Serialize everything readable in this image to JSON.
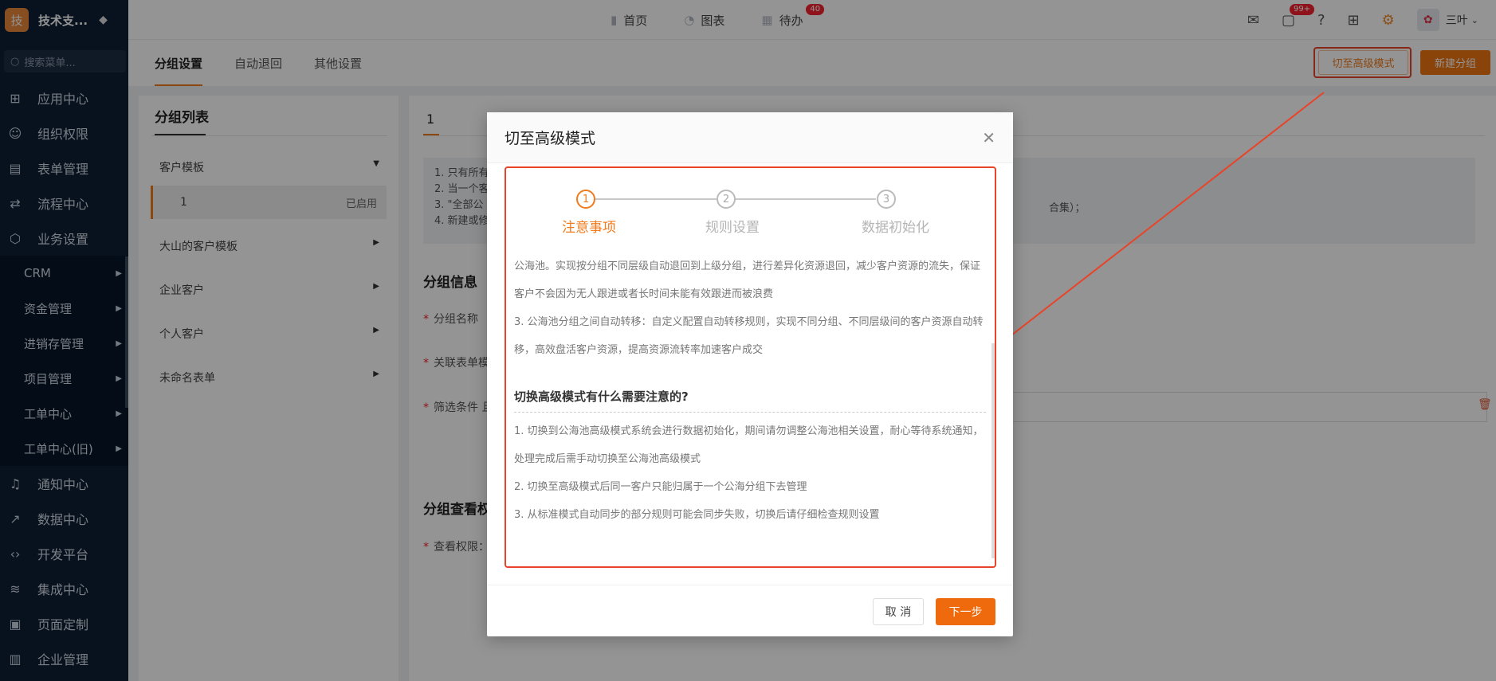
{
  "brand": {
    "logo_char": "技",
    "name": "技术支..."
  },
  "sidebar": {
    "search_placeholder": "搜索菜单...",
    "items_top": [
      {
        "label": "应用中心",
        "icon": "grid-icon"
      },
      {
        "label": "组织权限",
        "icon": "user-icon"
      },
      {
        "label": "表单管理",
        "icon": "form-icon"
      },
      {
        "label": "流程中心",
        "icon": "flow-icon"
      },
      {
        "label": "业务设置",
        "icon": "cube-icon"
      }
    ],
    "sub_items": [
      "CRM",
      "资金管理",
      "进销存管理",
      "项目管理",
      "工单中心",
      "工单中心(旧)"
    ],
    "items_bottom": [
      {
        "label": "通知中心",
        "icon": "bell-icon"
      },
      {
        "label": "数据中心",
        "icon": "chart-icon"
      },
      {
        "label": "开发平台",
        "icon": "code-icon"
      },
      {
        "label": "集成中心",
        "icon": "layers-icon"
      },
      {
        "label": "页面定制",
        "icon": "layout-icon"
      },
      {
        "label": "企业管理",
        "icon": "building-icon"
      }
    ]
  },
  "topnav": {
    "home": "首页",
    "charts": "图表",
    "todo": "待办",
    "todo_badge": "40",
    "msg_badge": "99+",
    "user": "三叶"
  },
  "tabs": [
    "分组设置",
    "自动退回",
    "其他设置"
  ],
  "buttons": {
    "advanced": "切至高级模式",
    "new_group": "新建分组"
  },
  "left_panel": {
    "title": "分组列表",
    "groups": [
      {
        "name": "客户模板",
        "expanded": true,
        "rows": [
          {
            "name": "1",
            "status": "已启用"
          }
        ]
      },
      {
        "name": "大山的客户模板"
      },
      {
        "name": "企业客户"
      },
      {
        "name": "个人客户"
      },
      {
        "name": "未命名表单"
      }
    ]
  },
  "right_panel": {
    "tab": "1",
    "notice": [
      "1. 只有所有",
      "2. 当一个客",
      "3. \"全部公",
      "4. 新建或修"
    ],
    "notice_tail": "合集）；",
    "section1": "分组信息",
    "fields": [
      "分组名称",
      "关联表单模",
      "筛选条件 且"
    ],
    "section2": "分组查看权",
    "field_view": "查看权限："
  },
  "modal": {
    "title": "切至高级模式",
    "steps": [
      {
        "num": "1",
        "label": "注意事项",
        "active": true
      },
      {
        "num": "2",
        "label": "规则设置",
        "active": false
      },
      {
        "num": "3",
        "label": "数据初始化",
        "active": false
      }
    ],
    "para1": "公海池。实现按分组不同层级自动退回到上级分组，进行差异化资源退回，减少客户资源的流失，保证客户不会因为无人跟进或者长时间未能有效跟进而被浪费",
    "para2": "3. 公海池分组之间自动转移：自定义配置自动转移规则，实现不同分组、不同层级间的客户资源自动转移，高效盘活客户资源，提高资源流转率加速客户成交",
    "heading": "切换高级模式有什么需要注意的?",
    "notes": [
      "1. 切换到公海池高级模式系统会进行数据初始化，期间请勿调整公海池相关设置，耐心等待系统通知，处理完成后需手动切换至公海池高级模式",
      "2. 切换至高级模式后同一客户只能归属于一个公海分组下去管理",
      "3. 从标准模式自动同步的部分规则可能会同步失败，切换后请仔细检查规则设置"
    ],
    "cancel": "取 消",
    "next": "下一步"
  },
  "colors": {
    "accent": "#f07b1d",
    "sidebar_bg": "#0e1e35",
    "annotation": "#e8442a"
  }
}
